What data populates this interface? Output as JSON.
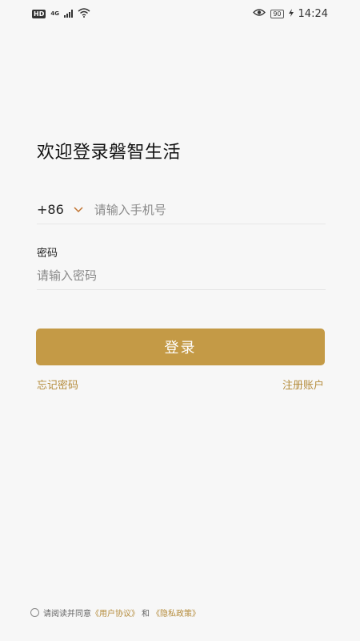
{
  "status_bar": {
    "hd": "HD",
    "network": "4G",
    "battery": "90",
    "time": "14:24"
  },
  "title": "欢迎登录磐智生活",
  "phone": {
    "country_code": "+86",
    "placeholder": "请输入手机号",
    "value": ""
  },
  "password": {
    "label": "密码",
    "placeholder": "请输入密码",
    "value": ""
  },
  "login_button": "登录",
  "forgot_password": "忘记密码",
  "register": "注册账户",
  "agreement": {
    "prefix": "请阅读并同意",
    "user_agreement": "《用户协议》",
    "and": "和",
    "privacy_policy": "《隐私政策》"
  },
  "colors": {
    "accent": "#c49a46",
    "link": "#b58c3c",
    "background": "#f7f7f7"
  },
  "icons": [
    "chevron-down-icon",
    "eye-icon",
    "wifi-icon",
    "signal-icon",
    "battery-icon",
    "charging-icon"
  ]
}
